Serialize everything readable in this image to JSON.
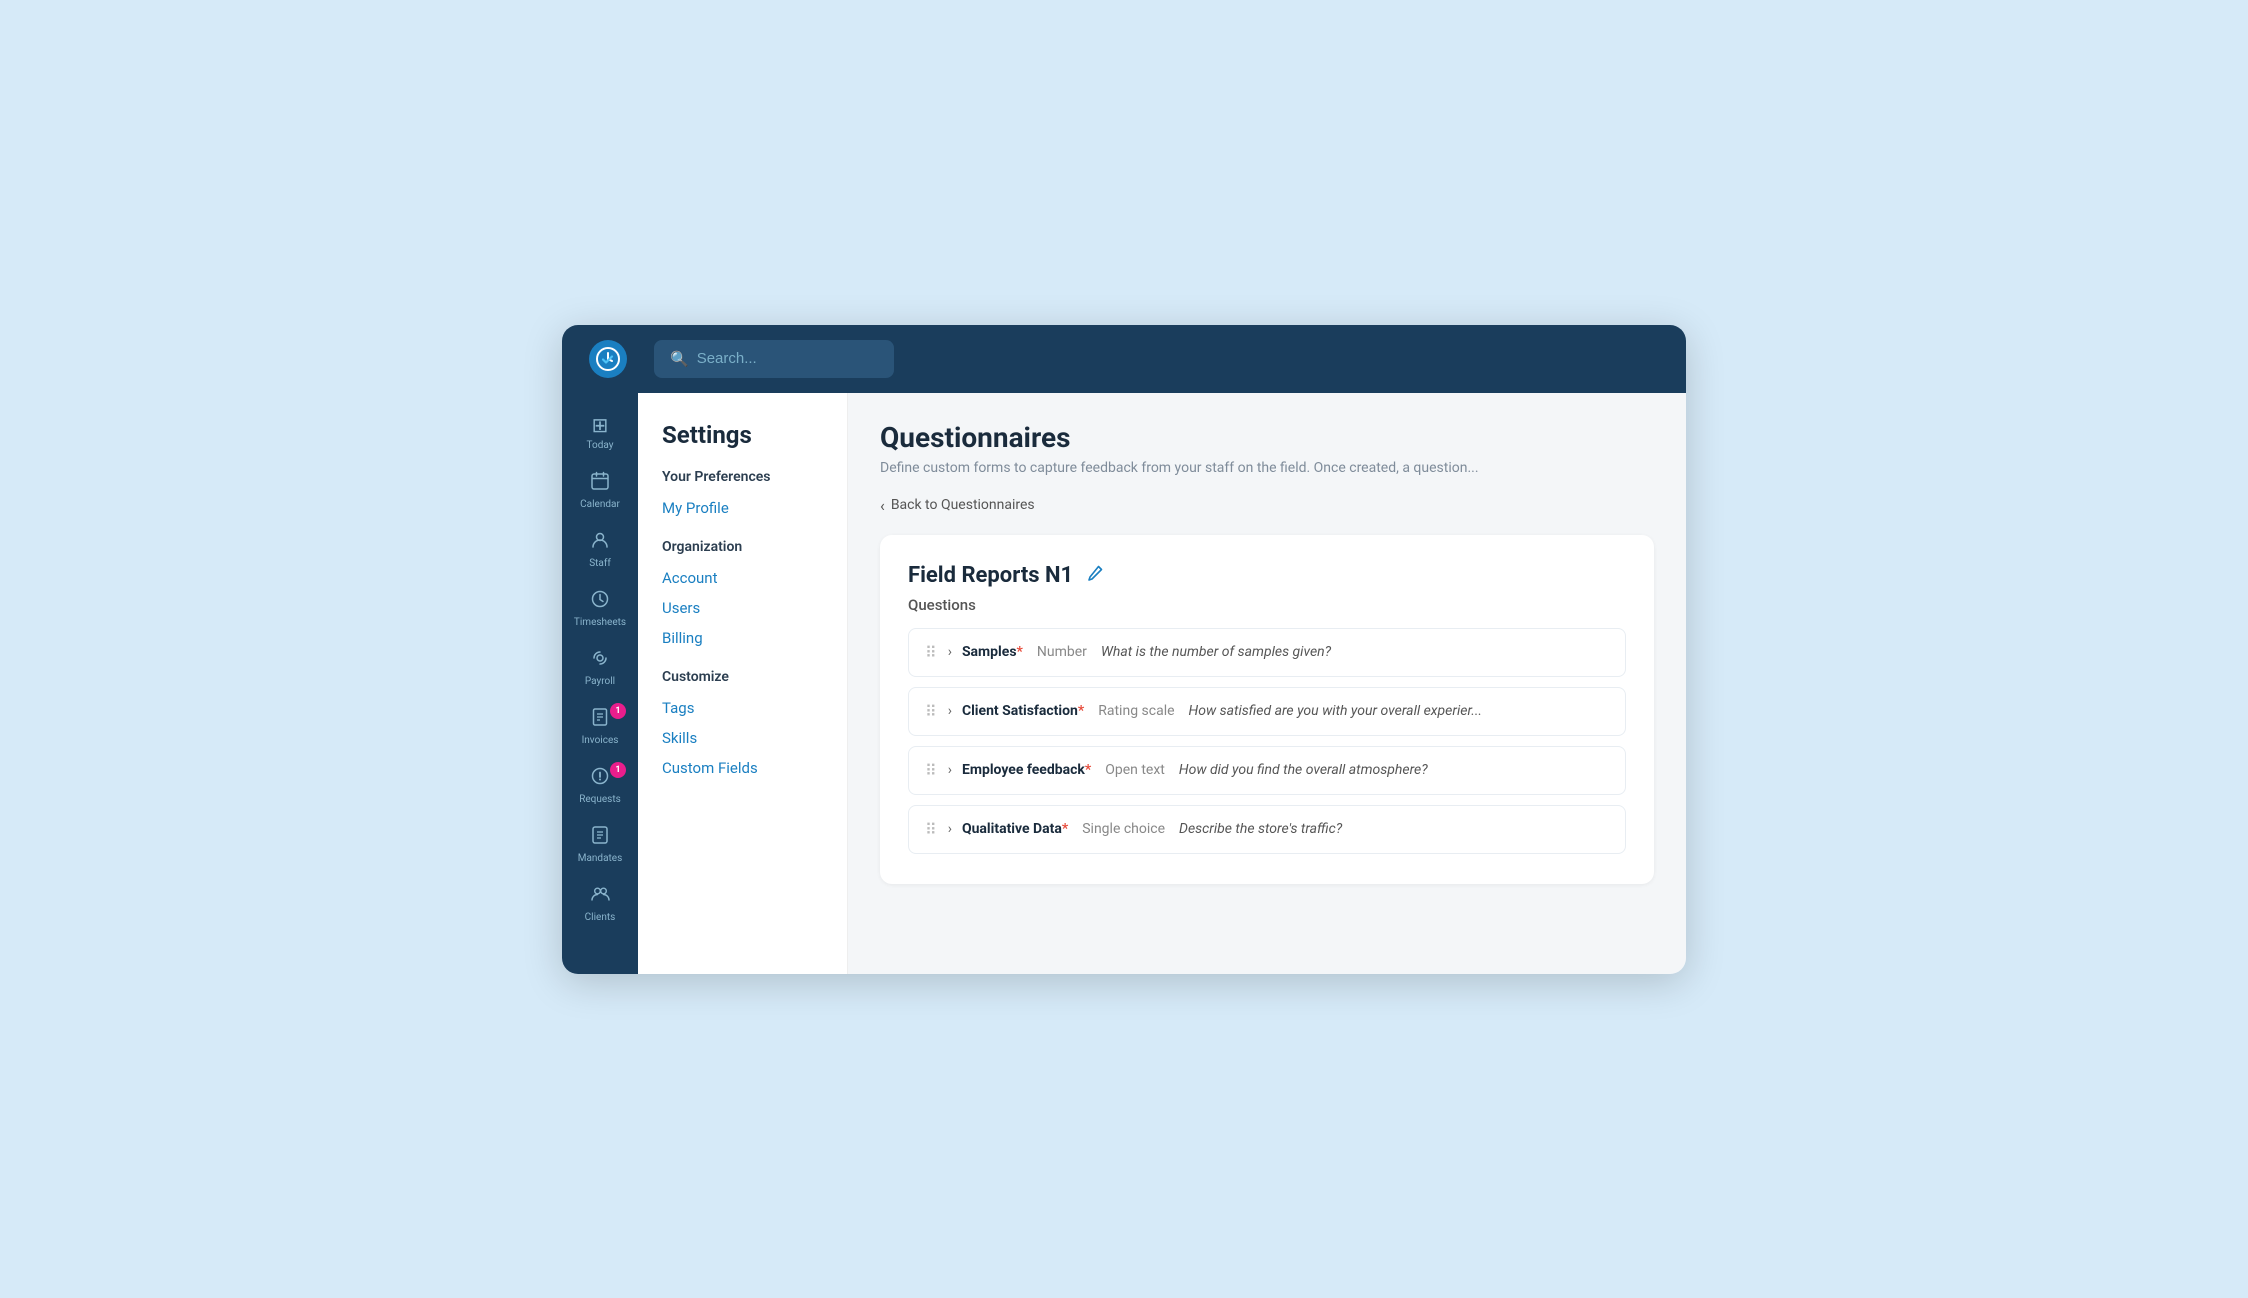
{
  "topbar": {
    "search_placeholder": "Search..."
  },
  "nav": {
    "items": [
      {
        "id": "today",
        "label": "Today",
        "icon": "⊞",
        "badge": null
      },
      {
        "id": "calendar",
        "label": "Calendar",
        "icon": "📅",
        "badge": null
      },
      {
        "id": "staff",
        "label": "Staff",
        "icon": "👤",
        "badge": null
      },
      {
        "id": "timesheets",
        "label": "Timesheets",
        "icon": "⏱",
        "badge": null
      },
      {
        "id": "payroll",
        "label": "Payroll",
        "icon": "💳",
        "badge": null
      },
      {
        "id": "invoices",
        "label": "Invoices",
        "icon": "📄",
        "badge": "1"
      },
      {
        "id": "requests",
        "label": "Requests",
        "icon": "⚠",
        "badge": "1"
      },
      {
        "id": "mandates",
        "label": "Mandates",
        "icon": "📋",
        "badge": null
      },
      {
        "id": "clients",
        "label": "Clients",
        "icon": "👥",
        "badge": null
      }
    ]
  },
  "settings": {
    "title": "Settings",
    "sections": [
      {
        "header": "Your Preferences",
        "items": [
          {
            "label": "My Profile",
            "id": "my-profile"
          }
        ]
      },
      {
        "header": "Organization",
        "items": [
          {
            "label": "Account",
            "id": "account"
          },
          {
            "label": "Users",
            "id": "users"
          },
          {
            "label": "Billing",
            "id": "billing"
          }
        ]
      },
      {
        "header": "Customize",
        "items": [
          {
            "label": "Tags",
            "id": "tags"
          },
          {
            "label": "Skills",
            "id": "skills"
          },
          {
            "label": "Custom Fields",
            "id": "custom-fields"
          }
        ]
      }
    ]
  },
  "page": {
    "title": "Questionnaires",
    "subtitle": "Define custom forms to capture feedback from your staff on the field. Once created, a question...",
    "back_label": "Back to Questionnaires",
    "card": {
      "title": "Field Reports N1",
      "questions_label": "Questions",
      "questions": [
        {
          "name": "Samples",
          "required": true,
          "type": "Number",
          "text": "What is the number of samples given?"
        },
        {
          "name": "Client Satisfaction",
          "required": true,
          "type": "Rating scale",
          "text": "How satisfied are you with your overall experier..."
        },
        {
          "name": "Employee feedback",
          "required": true,
          "type": "Open text",
          "text": "How did you find the overall atmosphere?"
        },
        {
          "name": "Qualitative Data",
          "required": true,
          "type": "Single choice",
          "text": "Describe the store's traffic?"
        }
      ]
    }
  }
}
